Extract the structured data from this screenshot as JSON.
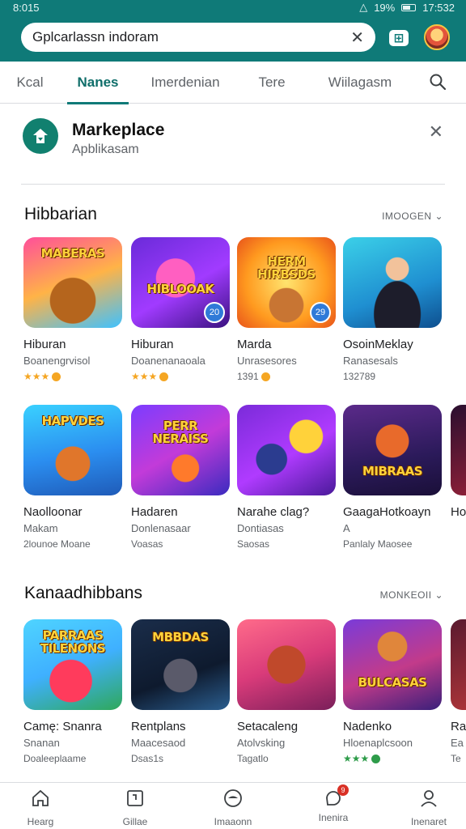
{
  "status_bar": {
    "time": "8:015",
    "right_time": "17:532",
    "battery": "19%"
  },
  "search": {
    "value": "Gplcarlassn indoram"
  },
  "tabs": [
    {
      "label": "Kcal"
    },
    {
      "label": "Nanes"
    },
    {
      "label": "Imerdenian"
    },
    {
      "label": "Tere"
    },
    {
      "label": "Wiilagasm"
    }
  ],
  "marketplace": {
    "title": "Markeplace",
    "subtitle": "Apblikasam"
  },
  "sections": [
    {
      "title": "Hibbarian",
      "more": "IMOOGEN",
      "cards": [
        {
          "name": "Hiburan",
          "sub": "Boanengrvisol",
          "meta": "",
          "rating": "★★★",
          "art_title": "MABERAS",
          "badge": ""
        },
        {
          "name": "Hiburan",
          "sub": "Doanenanaoala",
          "meta": "",
          "rating": "★★★",
          "art_title": "HIBLOOAK",
          "badge": "20"
        },
        {
          "name": "Marda",
          "sub": "Unrasesores",
          "meta": "1391",
          "rating": "",
          "art_title": "HERM HIRBSDS",
          "badge": "29"
        },
        {
          "name": "OsoinMeklay",
          "sub": "Ranasesals",
          "meta": "132789",
          "rating": "",
          "art_title": "",
          "badge": ""
        }
      ]
    },
    {
      "title": "",
      "more": "",
      "cards": [
        {
          "name": "Naolloonar",
          "sub": "Makam",
          "meta": "2lounoe Moane",
          "rating": "",
          "art_title": "HAPVDES",
          "badge": ""
        },
        {
          "name": "Hadaren",
          "sub": "Donlenasaar",
          "meta": "Voasas",
          "rating": "",
          "art_title": "PERR NERAISS",
          "badge": ""
        },
        {
          "name": "Narahe clag?",
          "sub": "Dontiasas",
          "meta": "Saosas",
          "rating": "",
          "art_title": "",
          "badge": ""
        },
        {
          "name": "GaagaHotkoayn",
          "sub": "A",
          "meta": "Panlaly Maosee",
          "rating": "",
          "art_title": "MIBRAAS",
          "badge": ""
        },
        {
          "name": "Ho",
          "sub": "",
          "meta": "",
          "rating": "",
          "art_title": "",
          "badge": ""
        }
      ]
    },
    {
      "title": "Kanaadhibbans",
      "more": "MONKEOII",
      "cards": [
        {
          "name": "Camę: Snanra",
          "sub": "Snanan",
          "meta": "Doaleeplaame",
          "rating": "",
          "art_title": "PARRAAS TILENONS",
          "badge": ""
        },
        {
          "name": "Rentplans",
          "sub": "Maacesaod",
          "meta": "Dsas1s",
          "rating": "",
          "art_title": "MBBDAS",
          "badge": ""
        },
        {
          "name": "Setacaleng",
          "sub": "Atolvsking",
          "meta": "Tagatlo",
          "rating": "",
          "art_title": "",
          "badge": ""
        },
        {
          "name": "Nadenko",
          "sub": "Hloenaplcsoon",
          "meta": "",
          "rating": "★★★",
          "art_title": "BULCASAS",
          "badge": ""
        },
        {
          "name": "Ra",
          "sub": "Ea",
          "meta": "Te",
          "rating": "",
          "art_title": "",
          "badge": ""
        }
      ]
    }
  ],
  "bottom_nav": [
    {
      "label": "Hearg",
      "icon": "home-icon"
    },
    {
      "label": "Gillae",
      "icon": "library-icon"
    },
    {
      "label": "Imaaonn",
      "icon": "games-icon"
    },
    {
      "label": "Inenira",
      "icon": "notifications-icon",
      "badge": "9"
    },
    {
      "label": "Inenaret",
      "icon": "account-icon"
    }
  ],
  "colors": {
    "header": "#0f7a78",
    "accent": "#0f6e6a",
    "star": "#f5a623"
  }
}
